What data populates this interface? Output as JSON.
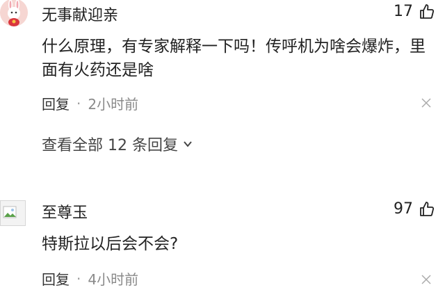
{
  "comments": [
    {
      "username": "无事献迎亲",
      "avatar_icon": "rabbit-avatar-icon",
      "likes": "17",
      "like_icon": "thumbs-up-icon",
      "text": "什么原理，有专家解释一下吗！传呼机为啥会爆炸，里面有火药还是啥",
      "reply_label": "回复",
      "separator": "·",
      "time": "2小时前",
      "view_replies": "查看全部 12 条回复",
      "close_icon": "close-icon"
    },
    {
      "username": "至尊玉",
      "avatar_icon": "broken-image-avatar-icon",
      "likes": "97",
      "like_icon": "thumbs-up-icon",
      "text": "特斯拉以后会不会?",
      "reply_label": "回复",
      "separator": "·",
      "time": "4小时前",
      "close_icon": "close-icon"
    }
  ]
}
